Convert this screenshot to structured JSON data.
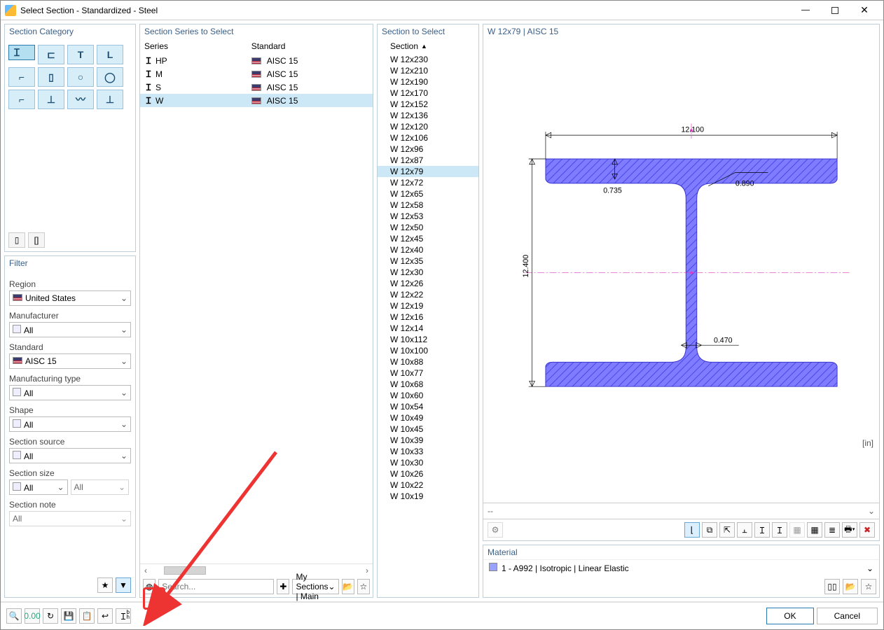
{
  "window": {
    "title": "Select Section - Standardized - Steel"
  },
  "panel": {
    "category": "Section Category",
    "series": "Section Series to Select",
    "section_select": "Section to Select",
    "filter": "Filter",
    "material": "Material"
  },
  "category": {
    "shapes": [
      "I",
      "C",
      "T",
      "L",
      "angle",
      "rect",
      "O",
      "oval",
      "Z",
      "tee2",
      "wave",
      "person"
    ]
  },
  "series": {
    "col_series": "Series",
    "col_standard": "Standard",
    "rows": [
      {
        "s": "HP",
        "std": "AISC 15",
        "sel": false
      },
      {
        "s": "M",
        "std": "AISC 15",
        "sel": false
      },
      {
        "s": "S",
        "std": "AISC 15",
        "sel": false
      },
      {
        "s": "W",
        "std": "AISC 15",
        "sel": true
      }
    ],
    "search_placeholder": "Search...",
    "mysections": "My Sections | Main"
  },
  "filter": {
    "region_l": "Region",
    "region_v": "United States",
    "manu_l": "Manufacturer",
    "manu_v": "All",
    "std_l": "Standard",
    "std_v": "AISC 15",
    "mtype_l": "Manufacturing type",
    "mtype_v": "All",
    "shape_l": "Shape",
    "shape_v": "All",
    "src_l": "Section source",
    "src_v": "All",
    "size_l": "Section size",
    "size_v1": "All",
    "size_v2": "All",
    "note_l": "Section note",
    "note_v": "All"
  },
  "section_list": {
    "header": "Section",
    "items": [
      "W 12x230",
      "W 12x210",
      "W 12x190",
      "W 12x170",
      "W 12x152",
      "W 12x136",
      "W 12x120",
      "W 12x106",
      "W 12x96",
      "W 12x87",
      "W 12x79",
      "W 12x72",
      "W 12x65",
      "W 12x58",
      "W 12x53",
      "W 12x50",
      "W 12x45",
      "W 12x40",
      "W 12x35",
      "W 12x30",
      "W 12x26",
      "W 12x22",
      "W 12x19",
      "W 12x16",
      "W 12x14",
      "W 10x112",
      "W 10x100",
      "W 10x88",
      "W 10x77",
      "W 10x68",
      "W 10x60",
      "W 10x54",
      "W 10x49",
      "W 10x45",
      "W 10x39",
      "W 10x33",
      "W 10x30",
      "W 10x26",
      "W 10x22",
      "W 10x19"
    ],
    "selected": "W 12x79"
  },
  "preview": {
    "title": "W 12x79 | AISC 15",
    "unit": "[in]",
    "mid": "--",
    "dims": {
      "bf": "12.100",
      "tf": "0.735",
      "r": "0.890",
      "h": "12.400",
      "tw": "0.470"
    }
  },
  "material_row": "1 - A992 | Isotropic | Linear Elastic",
  "buttons": {
    "ok": "OK",
    "cancel": "Cancel"
  }
}
